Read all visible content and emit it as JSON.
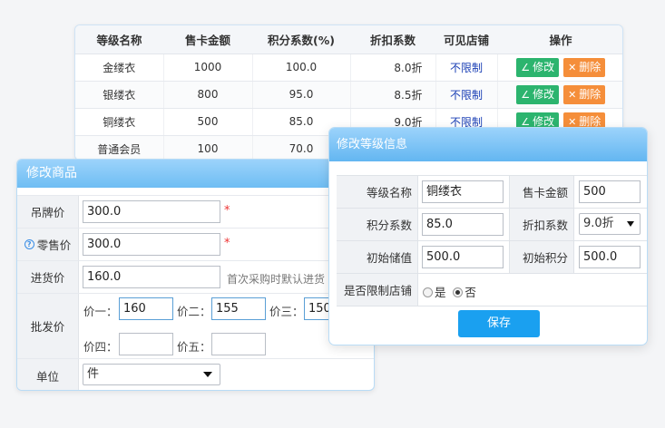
{
  "level_table": {
    "headers": [
      "等级名称",
      "售卡金额",
      "积分系数(%)",
      "折扣系数",
      "可见店铺",
      "操作"
    ],
    "rows": [
      {
        "name": "金缕衣",
        "price": "1000",
        "points": "100.0",
        "discount": "8.0折",
        "store": "不限制"
      },
      {
        "name": "银缕衣",
        "price": "800",
        "points": "95.0",
        "discount": "8.5折",
        "store": "不限制"
      },
      {
        "name": "铜缕衣",
        "price": "500",
        "points": "85.0",
        "discount": "9.0折",
        "store": "不限制"
      },
      {
        "name": "普通会员",
        "price": "100",
        "points": "70.0",
        "discount": "",
        "store": ""
      }
    ],
    "edit_label": "修改",
    "delete_label": "删除",
    "edit_icon": "pencil-icon",
    "delete_icon": "close-icon"
  },
  "product_panel": {
    "title": "修改商品",
    "tag_price_label": "吊牌价",
    "tag_price_value": "300.0",
    "retail_price_label": "零售价",
    "retail_price_value": "300.0",
    "cost_price_label": "进货价",
    "cost_price_value": "160.0",
    "cost_price_hint": "首次采购时默认进货",
    "wholesale_label": "批发价",
    "wholesale": [
      {
        "label": "价一：",
        "value": "160"
      },
      {
        "label": "价二：",
        "value": "155"
      },
      {
        "label": "价三：",
        "value": "150"
      },
      {
        "label": "价四：",
        "value": ""
      },
      {
        "label": "价五：",
        "value": ""
      }
    ],
    "unit_label": "单位",
    "unit_value": "件",
    "required_mark": "*",
    "help_icon": "question-icon"
  },
  "level_dialog": {
    "title": "修改等级信息",
    "level_name_label": "等级名称",
    "level_name_value": "铜缕衣",
    "card_price_label": "售卡金额",
    "card_price_value": "500",
    "points_label": "积分系数",
    "points_value": "85.0",
    "discount_label": "折扣系数",
    "discount_value": "9.0折",
    "init_balance_label": "初始储值",
    "init_balance_value": "500.0",
    "init_points_label": "初始积分",
    "init_points_value": "500.0",
    "limit_store_label": "是否限制店铺",
    "option_yes": "是",
    "option_no": "否",
    "selected_option": "否",
    "save_label": "保存"
  },
  "colors": {
    "accent_blue": "#1aa0f0",
    "edit_green": "#2cb46e",
    "delete_orange": "#f58e3a",
    "store_link": "#1a3fb5",
    "required_red": "#e33"
  }
}
